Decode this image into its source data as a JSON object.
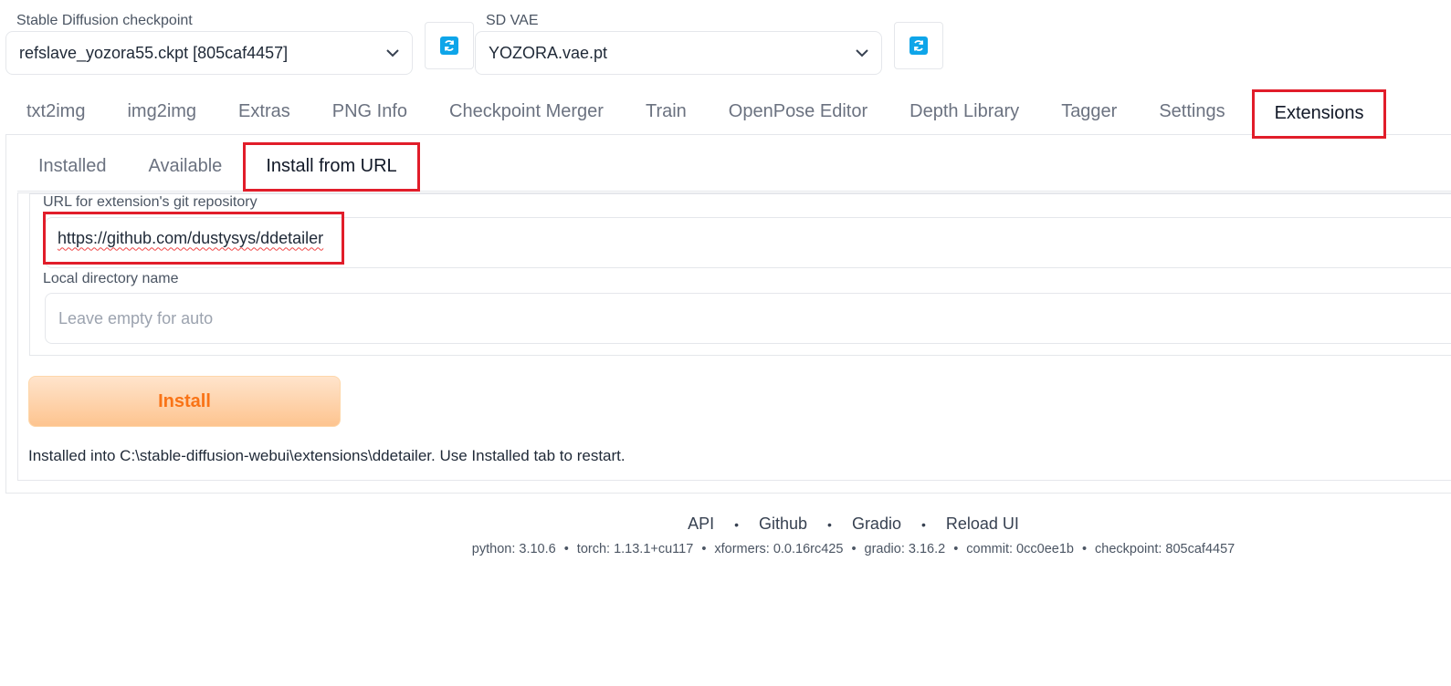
{
  "checkpoint": {
    "label": "Stable Diffusion checkpoint",
    "value": "refslave_yozora55.ckpt [805caf4457]"
  },
  "vae": {
    "label": "SD VAE",
    "value": "YOZORA.vae.pt"
  },
  "icons": {
    "refresh": "refresh-icon",
    "dropdown": "chevron-down-icon"
  },
  "main_tabs": [
    {
      "label": "txt2img"
    },
    {
      "label": "img2img"
    },
    {
      "label": "Extras"
    },
    {
      "label": "PNG Info"
    },
    {
      "label": "Checkpoint Merger"
    },
    {
      "label": "Train"
    },
    {
      "label": "OpenPose Editor"
    },
    {
      "label": "Depth Library"
    },
    {
      "label": "Tagger"
    },
    {
      "label": "Settings"
    },
    {
      "label": "Extensions"
    }
  ],
  "sub_tabs": [
    {
      "label": "Installed"
    },
    {
      "label": "Available"
    },
    {
      "label": "Install from URL"
    }
  ],
  "form": {
    "url_label": "URL for extension's git repository",
    "url_value": "https://github.com/dustysys/ddetailer",
    "dir_label": "Local directory name",
    "dir_placeholder": "Leave empty for auto",
    "install_label": "Install",
    "status": "Installed into C:\\stable-diffusion-webui\\extensions\\ddetailer. Use Installed tab to restart."
  },
  "footer": {
    "links": [
      "API",
      "Github",
      "Gradio",
      "Reload UI"
    ],
    "separator": "•",
    "info": [
      "python: 3.10.6",
      "torch: 1.13.1+cu117",
      "xformers: 0.0.16rc425",
      "gradio: 3.16.2",
      "commit: 0cc0ee1b",
      "checkpoint: 805caf4457"
    ]
  },
  "colors": {
    "highlight": "#e11d2a",
    "refresh_accent": "#0ea5e9",
    "install_text": "#f97316"
  }
}
